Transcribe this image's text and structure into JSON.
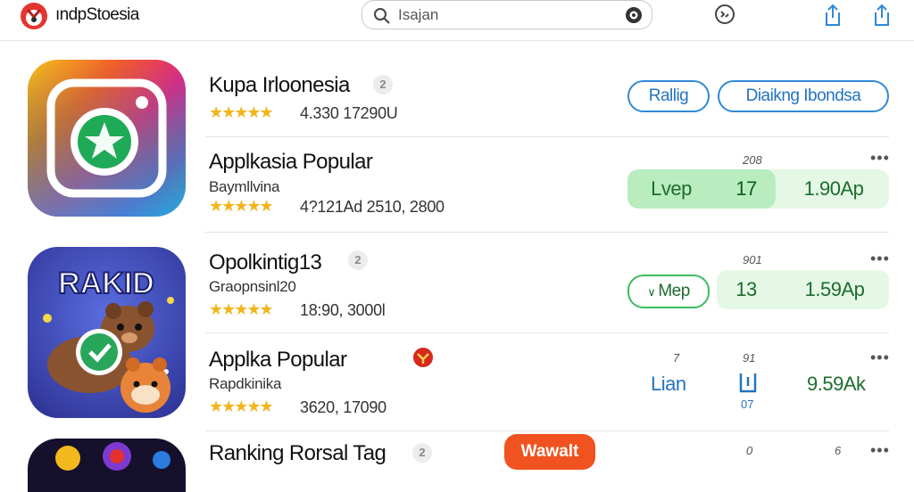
{
  "header": {
    "brand": "ındpStoesia",
    "search_value": "Isajan",
    "icons": [
      "app-logo-icon",
      "search-icon",
      "camera-icon",
      "settings-icon",
      "share-icon",
      "share-alt-icon"
    ]
  },
  "apps": [
    {
      "title": "Kupa Irloonesia",
      "badge": "2",
      "stars": "★★★★★",
      "meta": "4.330 17290U",
      "buttons": [
        "Rallig",
        "Diaikng Ibondsa"
      ]
    },
    {
      "title": "Applkasia Popular",
      "subtitle": "Baymllvina",
      "stars": "★★★★★",
      "meta": "4?121Ad 2510, 2800",
      "tag": "208",
      "bar": [
        "Lvep",
        "17",
        "1.90Ap"
      ]
    },
    {
      "title": "Opolkintig13",
      "badge": "2",
      "subtitle": "Graopnsinl20",
      "stars": "★★★★★",
      "meta": "18:90, 3000l",
      "tag": "901",
      "bar": [
        "Mep",
        "13",
        "1.59Ap"
      ]
    },
    {
      "title": "Applka Popular",
      "subtitle": "Rapdkinika",
      "stars": "★★★★★",
      "meta": "3620, 17090",
      "tag1": "7",
      "tag2": "91",
      "stat_label": "Lian",
      "stat_num": "07",
      "stat_value": "9.59Ak"
    },
    {
      "title": "Ranking Rorsal Tag",
      "badge": "2",
      "button": "Wawalt",
      "tag1": "0",
      "tag2": "6"
    }
  ],
  "colors": {
    "accent_blue": "#2f89d6",
    "green_fill": "#e4f8e5",
    "green_dark": "#b9edc0",
    "star": "#f1b51c",
    "orange": "#f0531f"
  }
}
